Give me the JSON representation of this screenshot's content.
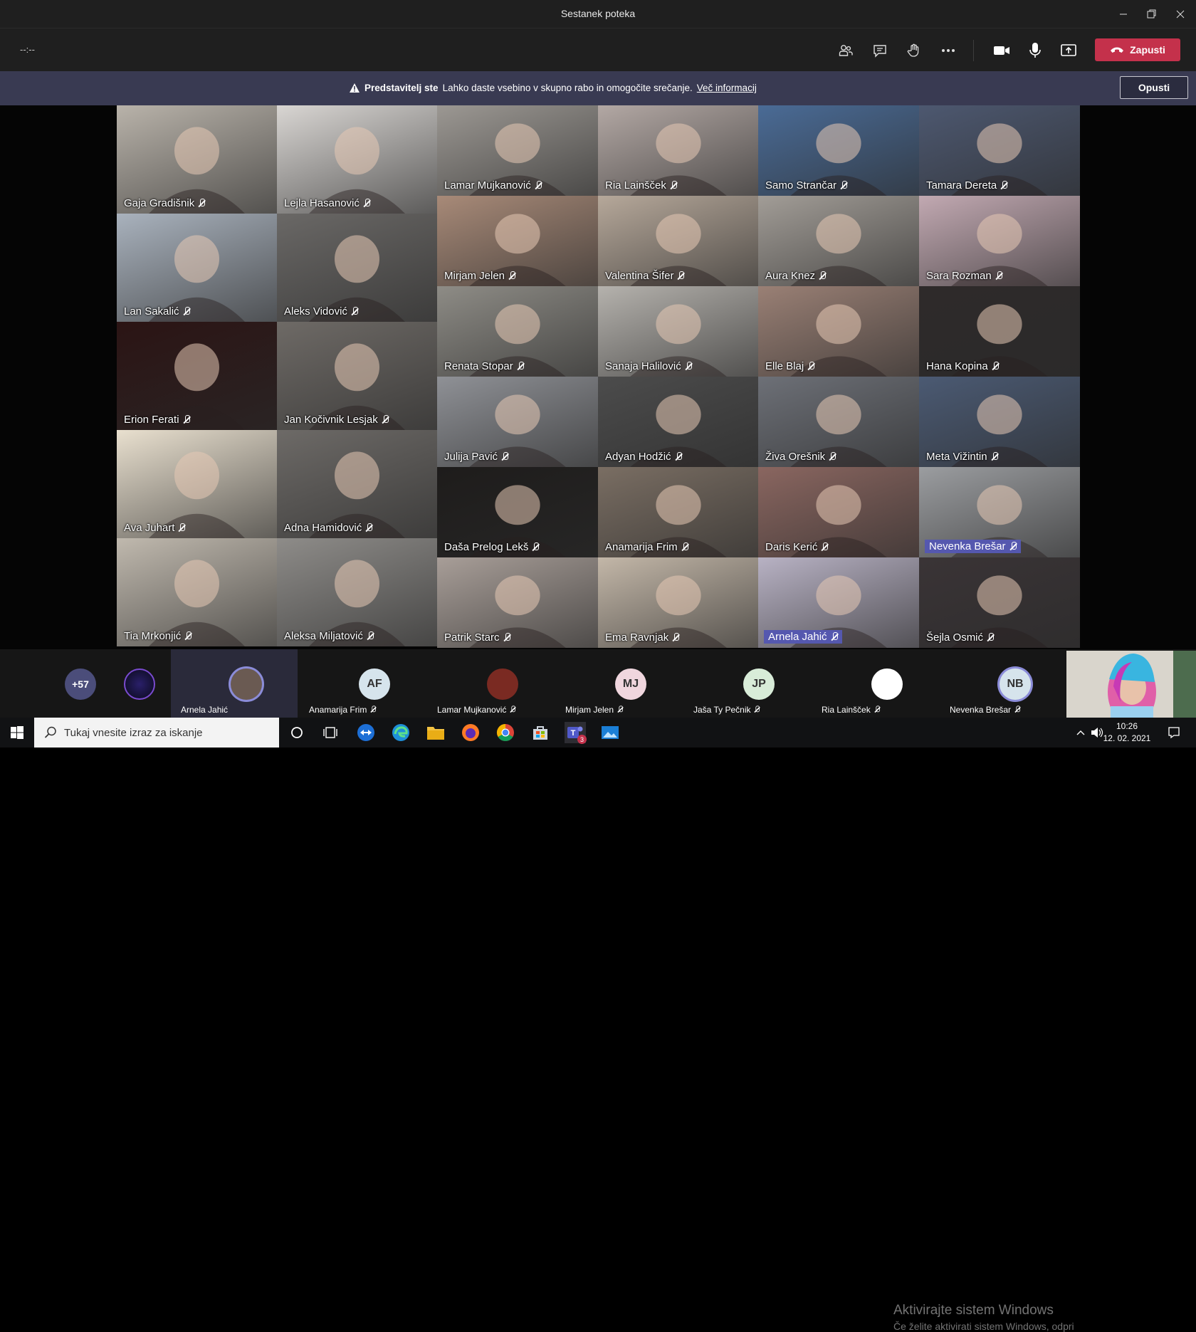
{
  "window": {
    "title": "Sestanek poteka"
  },
  "toolbar": {
    "timer": "--:--",
    "leave_label": "Zapusti"
  },
  "banner": {
    "bold": "Predstavitelj ste",
    "text": "Lahko daste vsebino v skupno rabo in omogočite srečanje.",
    "link": "Več informacij",
    "dismiss_label": "Opusti"
  },
  "tiles": [
    {
      "name": "Gaja Gradišnik",
      "bg": "#b9b3aa"
    },
    {
      "name": "Lejla Hasanović",
      "bg": "#d9d6d3"
    },
    {
      "name": "Lamar Mujkanović",
      "bg": "#9c9893"
    },
    {
      "name": "Ria Lainšček",
      "bg": "#b3a8a4"
    },
    {
      "name": "Samo Strančar",
      "bg": "#4a6b96"
    },
    {
      "name": "Tamara Dereta",
      "bg": "#4d5870"
    },
    {
      "name": "Lan Sakalić",
      "bg": "#a9b2bd"
    },
    {
      "name": "Aleks Vidović",
      "bg": "#6a6866"
    },
    {
      "name": "Mirjam Jelen",
      "bg": "#a88a78"
    },
    {
      "name": "Valentina Šifer",
      "bg": "#b6a89a"
    },
    {
      "name": "Aura Knez",
      "bg": "#a29d97"
    },
    {
      "name": "Sara Rozman",
      "bg": "#c2a9b2"
    },
    {
      "name": "Erion Ferati",
      "bg": "#2b1414"
    },
    {
      "name": "Jan Kočivnik Lesjak",
      "bg": "#6e6a66"
    },
    {
      "name": "Renata Stopar",
      "bg": "#8e8c86"
    },
    {
      "name": "Sanaja Halilović",
      "bg": "#b5b2ad"
    },
    {
      "name": "Elle Blaj",
      "bg": "#9a8075"
    },
    {
      "name": "Hana Kopina",
      "bg": "#2e2a2a"
    },
    {
      "name": "Julija Pavić",
      "bg": "#8f9196"
    },
    {
      "name": "Adyan Hodžić",
      "bg": "#4c4c4c"
    },
    {
      "name": "Živa Orešnik",
      "bg": "#6d7077"
    },
    {
      "name": "Meta Vižintin",
      "bg": "#4b5a73"
    },
    {
      "name": "Ava Juhart",
      "bg": "#e9e0cf"
    },
    {
      "name": "Adna Hamidović",
      "bg": "#6d6a67"
    },
    {
      "name": "Daša Prelog Lekš",
      "bg": "#1e1c1b"
    },
    {
      "name": "Anamarija Frim",
      "bg": "#7a6e63"
    },
    {
      "name": "Daris Kerić",
      "bg": "#8a6660"
    },
    {
      "name": "Nevenka Brešar",
      "bg": "#9b9da0",
      "highlight": true
    },
    {
      "name": "Tia Mrkonjić",
      "bg": "#c0b9ae"
    },
    {
      "name": "Aleksa Miljatović",
      "bg": "#8e8c89"
    },
    {
      "name": "Patrik Starc",
      "bg": "#a89e98"
    },
    {
      "name": "Ema Ravnjak",
      "bg": "#c3b7a8"
    },
    {
      "name": "Arnela Jahić",
      "bg": "#b8b2c4",
      "highlight": true
    },
    {
      "name": "Šejla Osmić",
      "bg": "#3a3436"
    }
  ],
  "strip": {
    "overflow_count": "+57",
    "participants": [
      {
        "name": "Arnela Jahić",
        "initials": "",
        "avatar_color": "#6a5a52",
        "active": true
      },
      {
        "name": "Anamarija Frim",
        "initials": "AF",
        "avatar_color": "#d6e4ec"
      },
      {
        "name": "Lamar Mujkanović",
        "initials": "",
        "avatar_color": "#7a2a22"
      },
      {
        "name": "Mirjam Jelen",
        "initials": "MJ",
        "avatar_color": "#f0d6de"
      },
      {
        "name": "Jaša Ty Pečnik",
        "initials": "JP",
        "avatar_color": "#d8ecd8"
      },
      {
        "name": "Ria Lainšček",
        "initials": "",
        "avatar_color": "#ffffff"
      },
      {
        "name": "Nevenka Brešar",
        "initials": "NB",
        "avatar_color": "#d6e4ec"
      }
    ]
  },
  "activation": {
    "line1": "Aktivirajte sistem Windows",
    "line2": "Če želite aktivirati sistem Windows, odpri"
  },
  "taskbar": {
    "search_placeholder": "Tukaj vnesite izraz za iskanje",
    "time": "10:26",
    "date": "12. 02. 2021",
    "teams_badge": "3"
  }
}
